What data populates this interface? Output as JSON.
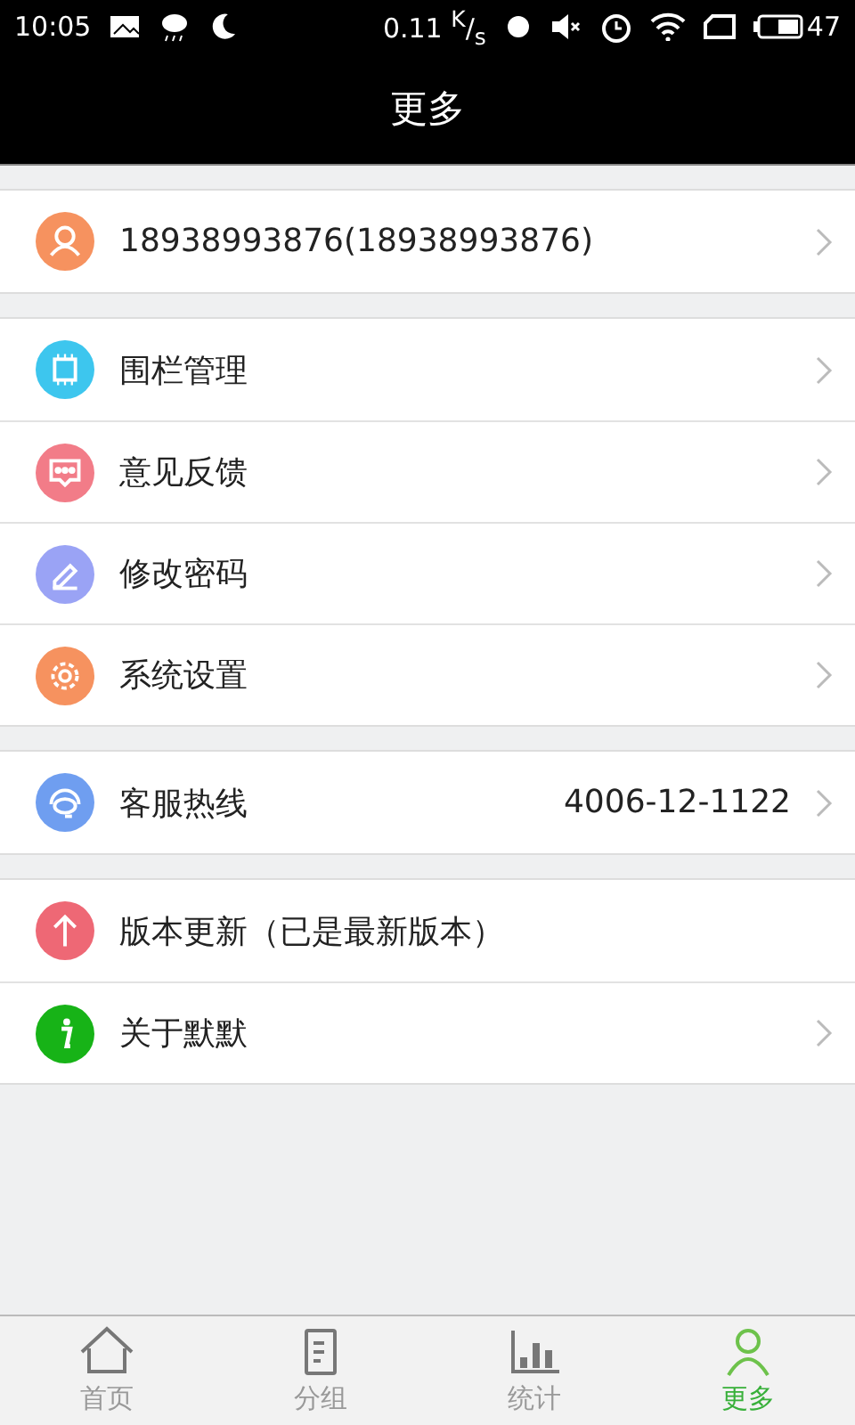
{
  "status_bar": {
    "time": "10:05",
    "speed": "0.11 $^{K}$/$_{s}$",
    "battery": "47"
  },
  "title": "更多",
  "groups": [
    {
      "rows": [
        {
          "kind": "user",
          "color": "#f6925f",
          "label": "18938993876(18938993876)",
          "chevron": true
        }
      ]
    },
    {
      "rows": [
        {
          "kind": "chip",
          "color": "#3dc6ee",
          "label": "围栏管理",
          "chevron": true
        },
        {
          "kind": "chat",
          "color": "#f27c88",
          "label": "意见反馈",
          "chevron": true
        },
        {
          "kind": "pen",
          "color": "#9aa3f5",
          "label": "修改密码",
          "chevron": true
        },
        {
          "kind": "gear",
          "color": "#f6925f",
          "label": "系统设置",
          "chevron": true
        }
      ]
    },
    {
      "rows": [
        {
          "kind": "headset",
          "color": "#6f9ef0",
          "label": "客服热线",
          "value": "4006-12-1122",
          "chevron": true
        }
      ]
    },
    {
      "rows": [
        {
          "kind": "arrow",
          "color": "#ee6875",
          "label": "版本更新（已是最新版本）",
          "chevron": false
        },
        {
          "kind": "info",
          "color": "#17b317",
          "label": "关于默默",
          "chevron": true
        }
      ]
    }
  ],
  "tabs": [
    {
      "kind": "home",
      "label": "首页",
      "selected": false
    },
    {
      "kind": "list",
      "label": "分组",
      "selected": false
    },
    {
      "kind": "chart",
      "label": "统计",
      "selected": false
    },
    {
      "kind": "user",
      "label": "更多",
      "selected": true
    }
  ]
}
